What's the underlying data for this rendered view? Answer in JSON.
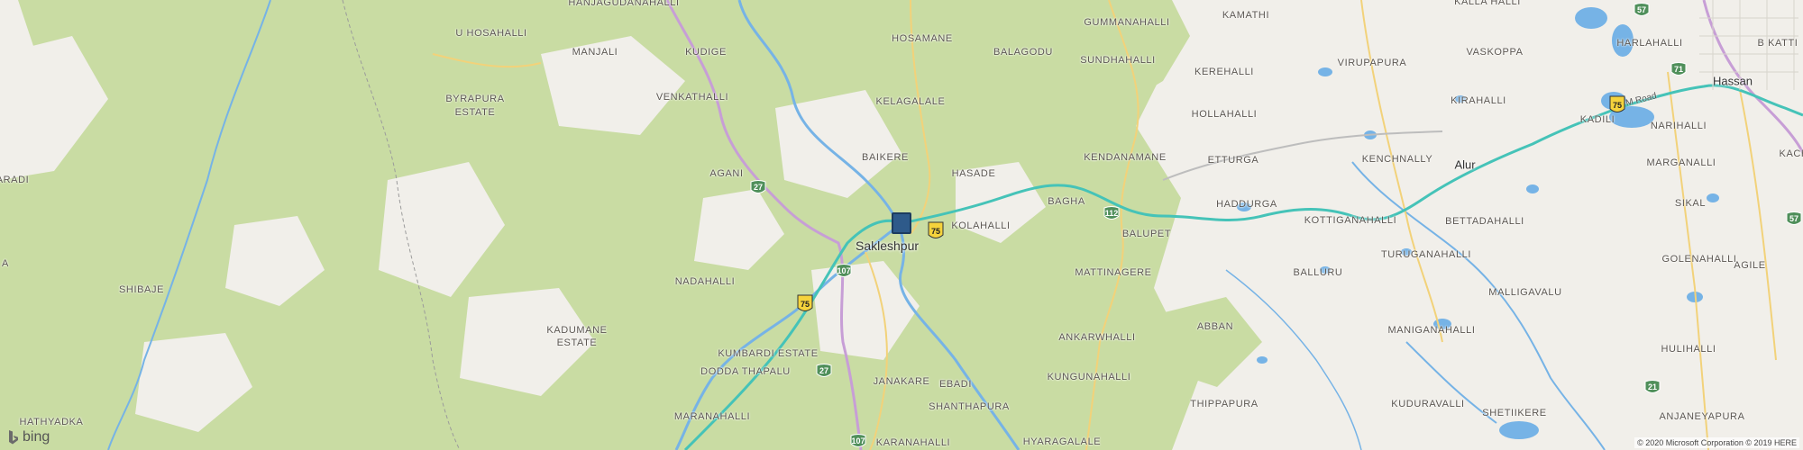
{
  "map": {
    "center_town": "Sakleshpur",
    "towns": [
      "Alur",
      "Hassan"
    ],
    "villages": [
      "HANJAGUDANAHALLI",
      "U HOSAHALLI",
      "MANJALI",
      "KUDIGE",
      "BYRAPURA",
      "ESTATE",
      "VENKATHALLI",
      "ARADI",
      "AGANI",
      "A",
      "SHIBAJE",
      "NADAHALLI",
      "KADUMANE",
      "ESTATE",
      "KUMBARDI ESTATE",
      "DODDA THAPALU",
      "MARANAHALLI",
      "HATHYADKA",
      "HOSAMANE",
      "BALAGODU",
      "KELAGALALE",
      "BAIKERE",
      "HASADE",
      "KOLAHALLI",
      "JANAKARE",
      "EBADI",
      "SHANTHAPURA",
      "KARANAHALLI",
      "GUMMANAHALLI",
      "SUNDHAHALLI",
      "KENDANAMANE",
      "BAGHA",
      "BALUPET",
      "MATTINAGERE",
      "ANKARWHALLI",
      "KUNGUNAHALLI",
      "HYARAGALALE",
      "ABBAN",
      "THIPPAPURA",
      "KAMATHI",
      "KEREHALLI",
      "HOLLAHALLI",
      "ETTURGA",
      "HADDURGA",
      "VIRUPAPURA",
      "VASKOPPA",
      "KALLA HALLI",
      "KIRAHALLI",
      "KENCHNALLY",
      "KOTTIGANAHALLI",
      "BALLURU",
      "TURUGANAHALLI",
      "MANIGANAHALLI",
      "KUDURAVALLI",
      "BETTADAHALLI",
      "MALLIGAVALU",
      "SHETIIKERE",
      "HARLAHALLI",
      "B KATTI",
      "KADILI",
      "NARIHALLI",
      "MARGANALLI",
      "SIKAL",
      "GOLENAHALLI",
      "AGILE",
      "HULIHALLI",
      "ANJANEYAPURA",
      "KACH"
    ],
    "road_names": [
      "B M Road"
    ],
    "nh_shields": [
      "27",
      "107",
      "27",
      "107",
      "112",
      "57",
      "71",
      "21",
      "57"
    ],
    "sh_shields": [
      "75",
      "75",
      "75"
    ],
    "logo_text": "bing",
    "copyright": "© 2020 Microsoft Corporation © 2019 HERE"
  },
  "colors": {
    "land": "#f1efea",
    "forest": "#c9dca3",
    "water": "#76b3e6",
    "highway": "#45c3b8",
    "primary_road": "#c79ed6",
    "secondary_road": "#f2d27a",
    "pin": "#2e5a8a"
  }
}
